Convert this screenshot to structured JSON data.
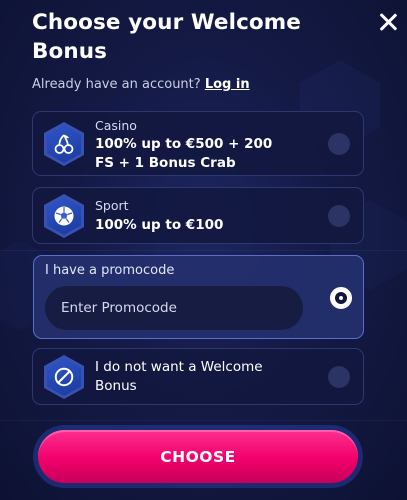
{
  "header": {
    "title": "Choose your Welcome Bonus",
    "close_icon": "close-icon"
  },
  "account": {
    "prompt": "Already have an account?",
    "login_link": "Log in"
  },
  "options": [
    {
      "id": "casino",
      "icon": "cherries-icon",
      "label": "Casino",
      "value": "100% up to €500 + 200 FS + 1 Bonus Crab",
      "selected": false
    },
    {
      "id": "sport",
      "icon": "soccer-ball-icon",
      "label": "Sport",
      "value": "100% up to €100",
      "selected": false
    },
    {
      "id": "promocode",
      "label": "I have a promocode",
      "input_placeholder": "Enter Promocode",
      "input_value": "",
      "selected": true
    },
    {
      "id": "no-bonus",
      "icon": "prohibited-icon",
      "label": "I do not want a Welcome Bonus",
      "selected": false
    }
  ],
  "cta": {
    "label": "CHOOSE"
  },
  "colors": {
    "background": "#141a45",
    "card": "#12183e",
    "card_border": "#2e3870",
    "promo_card": "#24306e",
    "icon_blue": "#2f56c8",
    "cta_pink": "#f0006b"
  }
}
